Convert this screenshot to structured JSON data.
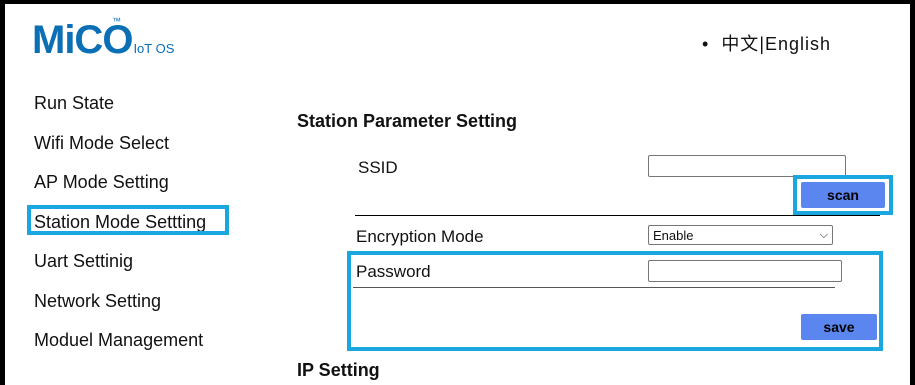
{
  "header": {
    "logo_main": "MiCO",
    "logo_sub": "IoT OS",
    "logo_tm": "™",
    "lang_bullet": "•",
    "lang_chinese": "中文",
    "lang_sep": "|",
    "lang_english": "English"
  },
  "sidebar": {
    "items": [
      {
        "label": "Run State"
      },
      {
        "label": "Wifi Mode Select"
      },
      {
        "label": "AP Mode Setting"
      },
      {
        "label": "Station Mode Settting"
      },
      {
        "label": "Uart Settinig"
      },
      {
        "label": "Network Setting"
      },
      {
        "label": "Moduel Management"
      }
    ],
    "active_index": 3
  },
  "main": {
    "station_title": "Station Parameter Setting",
    "ssid_label": "SSID",
    "ssid_value": "",
    "scan_label": "scan",
    "encryption_label": "Encryption Mode",
    "encryption_value": "Enable",
    "password_label": "Password",
    "password_value": "",
    "save_label": "save",
    "ip_title": "IP Setting"
  },
  "colors": {
    "highlight": "#1aa7e0",
    "button": "#5b86f0",
    "logo": "#0b6fb6"
  }
}
